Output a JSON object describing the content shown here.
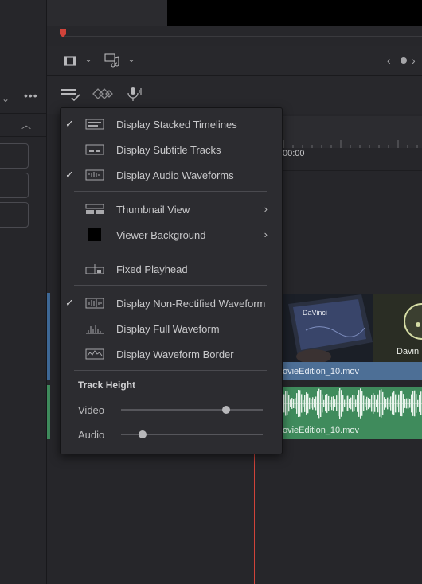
{
  "timeline": {
    "ruler_time": "00:00",
    "video_clip_label": "ovieEdition_10.mov",
    "audio_clip_label": "ovieEdition_10.mov",
    "thumb_text_1": "DaVinci",
    "thumb_text_2": "Davin"
  },
  "menu": {
    "items": [
      {
        "label": "Display Stacked Timelines",
        "checked": true,
        "icon": "stacked-timelines-icon"
      },
      {
        "label": "Display Subtitle Tracks",
        "checked": false,
        "icon": "subtitle-tracks-icon"
      },
      {
        "label": "Display Audio Waveforms",
        "checked": true,
        "icon": "audio-waveforms-icon"
      },
      {
        "label": "Thumbnail View",
        "checked": false,
        "icon": "thumbnail-view-icon",
        "submenu": true
      },
      {
        "label": "Viewer Background",
        "checked": false,
        "icon": "viewer-background-swatch",
        "submenu": true
      },
      {
        "label": "Fixed Playhead",
        "checked": false,
        "icon": "fixed-playhead-icon"
      },
      {
        "label": "Display Non-Rectified Waveform",
        "checked": true,
        "icon": "non-rectified-waveform-icon"
      },
      {
        "label": "Display Full Waveform",
        "checked": false,
        "icon": "full-waveform-icon"
      },
      {
        "label": "Display Waveform Border",
        "checked": false,
        "icon": "waveform-border-icon"
      }
    ],
    "check_glyph": "✓",
    "submenu_glyph": "›",
    "track_height": {
      "title": "Track Height",
      "video_label": "Video",
      "video_value": 0.74,
      "audio_label": "Audio",
      "audio_value": 0.15
    }
  },
  "colors": {
    "playhead": "#d0433a",
    "video_clip": "#4d6f96",
    "audio_clip": "#3f8b5c"
  }
}
